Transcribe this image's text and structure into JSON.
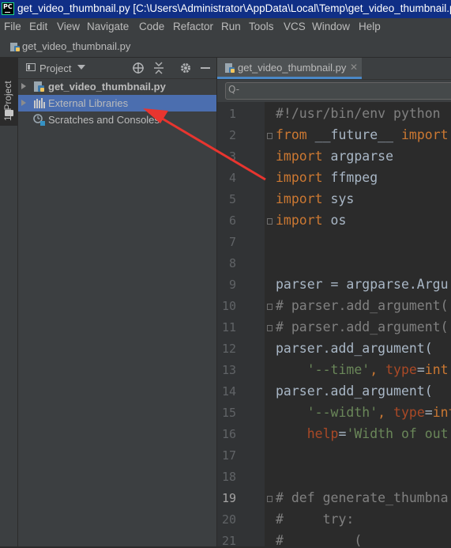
{
  "window": {
    "title": "get_video_thumbnail.py [C:\\Users\\Administrator\\AppData\\Local\\Temp\\get_video_thumbnail.py]",
    "app_icon_text": "PC"
  },
  "menu": [
    "File",
    "Edit",
    "View",
    "Navigate",
    "Code",
    "Refactor",
    "Run",
    "Tools",
    "VCS",
    "Window",
    "Help"
  ],
  "breadcrumb": "get_video_thumbnail.py",
  "tool_stripe": {
    "project_tab": "1: Project"
  },
  "project_panel": {
    "title": "Project",
    "tree": [
      {
        "label": "get_video_thumbnail.py",
        "icon": "python-file-icon"
      },
      {
        "label": "External Libraries",
        "icon": "libraries-icon",
        "selected": true
      },
      {
        "label": "Scratches and Consoles",
        "icon": "scratches-icon"
      }
    ]
  },
  "editor": {
    "tab_label": "get_video_thumbnail.py",
    "search_placeholder": "Q-",
    "current_line": 19,
    "lines": [
      {
        "n": "1",
        "tokens": [
          {
            "t": "#!/usr/bin/env python",
            "c": "cmt"
          }
        ]
      },
      {
        "n": "2",
        "tokens": [
          {
            "t": "from ",
            "c": "kw"
          },
          {
            "t": "__future__ ",
            "c": "name"
          },
          {
            "t": "import",
            "c": "kw"
          }
        ]
      },
      {
        "n": "3",
        "tokens": [
          {
            "t": "import ",
            "c": "kw"
          },
          {
            "t": "argparse",
            "c": "name"
          }
        ]
      },
      {
        "n": "4",
        "tokens": [
          {
            "t": "import ",
            "c": "kw"
          },
          {
            "t": "ffmpeg",
            "c": "name"
          }
        ]
      },
      {
        "n": "5",
        "tokens": [
          {
            "t": "import ",
            "c": "kw"
          },
          {
            "t": "sys",
            "c": "name"
          }
        ]
      },
      {
        "n": "6",
        "tokens": [
          {
            "t": "import ",
            "c": "kw"
          },
          {
            "t": "os",
            "c": "name"
          }
        ]
      },
      {
        "n": "7",
        "tokens": []
      },
      {
        "n": "8",
        "tokens": []
      },
      {
        "n": "9",
        "tokens": [
          {
            "t": "parser = argparse.Argu",
            "c": "name"
          }
        ]
      },
      {
        "n": "10",
        "tokens": [
          {
            "t": "# parser.add_argument(",
            "c": "cmt"
          }
        ]
      },
      {
        "n": "11",
        "tokens": [
          {
            "t": "# parser.add_argument(",
            "c": "cmt"
          }
        ]
      },
      {
        "n": "12",
        "tokens": [
          {
            "t": "parser.add_argument(",
            "c": "name"
          }
        ]
      },
      {
        "n": "13",
        "tokens": [
          {
            "t": "    ",
            "c": "name"
          },
          {
            "t": "'--time'",
            "c": "str"
          },
          {
            "t": ", ",
            "c": "kw"
          },
          {
            "t": "type",
            "c": "param"
          },
          {
            "t": "=",
            "c": "op"
          },
          {
            "t": "int",
            "c": "kw"
          }
        ]
      },
      {
        "n": "14",
        "tokens": [
          {
            "t": "parser.add_argument(",
            "c": "name"
          }
        ]
      },
      {
        "n": "15",
        "tokens": [
          {
            "t": "    ",
            "c": "name"
          },
          {
            "t": "'--width'",
            "c": "str"
          },
          {
            "t": ", ",
            "c": "kw"
          },
          {
            "t": "type",
            "c": "param"
          },
          {
            "t": "=",
            "c": "op"
          },
          {
            "t": "int",
            "c": "kw"
          }
        ]
      },
      {
        "n": "16",
        "tokens": [
          {
            "t": "    ",
            "c": "name"
          },
          {
            "t": "help",
            "c": "param"
          },
          {
            "t": "=",
            "c": "op"
          },
          {
            "t": "'Width of out",
            "c": "str"
          }
        ]
      },
      {
        "n": "17",
        "tokens": []
      },
      {
        "n": "18",
        "tokens": []
      },
      {
        "n": "19",
        "tokens": [
          {
            "t": "# def generate_thumbna",
            "c": "cmt"
          }
        ]
      },
      {
        "n": "20",
        "tokens": [
          {
            "t": "#     try:",
            "c": "cmt"
          }
        ]
      },
      {
        "n": "21",
        "tokens": [
          {
            "t": "#         (",
            "c": "cmt"
          }
        ]
      }
    ],
    "folded_lines": [
      2,
      6,
      10,
      11,
      19
    ]
  },
  "colors": {
    "title_bar": "#102f86",
    "selection": "#4b6eaf",
    "annotation_arrow": "#e8352f"
  }
}
